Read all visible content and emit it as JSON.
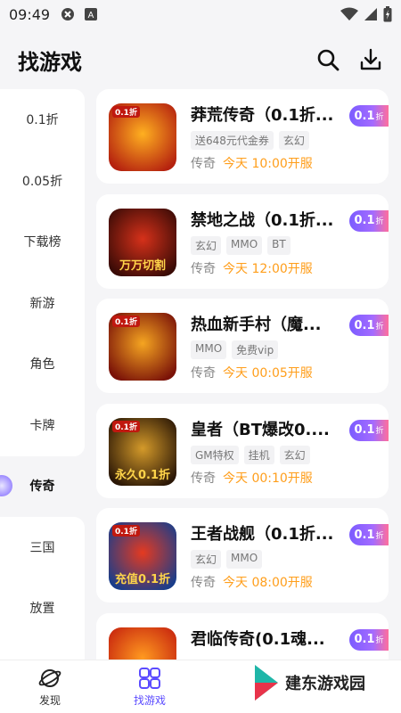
{
  "status_bar": {
    "time": "09:49"
  },
  "header": {
    "title": "找游戏"
  },
  "sidebar": {
    "items": [
      {
        "label": "0.1折"
      },
      {
        "label": "0.05折"
      },
      {
        "label": "下载榜"
      },
      {
        "label": "新游"
      },
      {
        "label": "角色"
      },
      {
        "label": "卡牌"
      },
      {
        "label": "传奇"
      },
      {
        "label": "三国"
      },
      {
        "label": "放置"
      }
    ],
    "active_index": 6
  },
  "games": [
    {
      "title": "莽荒传奇（0.1折...",
      "tags": [
        "送648元代金券",
        "玄幻"
      ],
      "category": "传奇",
      "open_time": "今天 10:00开服",
      "discount": "0.1",
      "discount_unit": "折",
      "cover_badge": "0.1折",
      "cover_caption": "",
      "cover_colors": [
        "#ffb020",
        "#b5220f"
      ]
    },
    {
      "title": "禁地之战（0.1折...",
      "tags": [
        "玄幻",
        "MMO",
        "BT"
      ],
      "category": "传奇",
      "open_time": "今天 12:00开服",
      "discount": "0.1",
      "discount_unit": "折",
      "cover_badge": "",
      "cover_caption": "万万切割",
      "cover_colors": [
        "#d6311a",
        "#3a0b06"
      ]
    },
    {
      "title": "热血新手村（魔...",
      "tags": [
        "MMO",
        "免费vip"
      ],
      "category": "传奇",
      "open_time": "今天 00:05开服",
      "discount": "0.1",
      "discount_unit": "折",
      "cover_badge": "0.1折",
      "cover_caption": "",
      "cover_colors": [
        "#f5a521",
        "#7a1208"
      ]
    },
    {
      "title": "皇者（BT爆改0....",
      "tags": [
        "GM特权",
        "挂机",
        "玄幻"
      ],
      "category": "传奇",
      "open_time": "今天 00:10开服",
      "discount": "0.1",
      "discount_unit": "折",
      "cover_badge": "0.1折",
      "cover_caption": "永久0.1折",
      "cover_colors": [
        "#d49a2a",
        "#2b1706"
      ]
    },
    {
      "title": "王者战舰（0.1折...",
      "tags": [
        "玄幻",
        "MMO"
      ],
      "category": "传奇",
      "open_time": "今天 08:00开服",
      "discount": "0.1",
      "discount_unit": "折",
      "cover_badge": "0.1折",
      "cover_caption": "充值0.1折",
      "cover_colors": [
        "#e53a20",
        "#1a3d8a"
      ]
    },
    {
      "title": "君临传奇(0.1魂...",
      "tags": [],
      "category": "",
      "open_time": "",
      "discount": "0.1",
      "discount_unit": "折",
      "cover_badge": "",
      "cover_caption": "",
      "cover_colors": [
        "#ff9a20",
        "#c8260e"
      ]
    }
  ],
  "bottom_nav": {
    "items": [
      {
        "label": "发现",
        "icon": "planet-icon"
      },
      {
        "label": "找游戏",
        "icon": "grid-icon"
      }
    ],
    "active_index": 1
  },
  "watermark": {
    "text": "建东游戏园"
  },
  "colors": {
    "accent": "#5b4bff",
    "time_orange": "#ff9e1b",
    "badge_gradient_start": "#7b5cff",
    "badge_gradient_end": "#ff6f9c"
  }
}
